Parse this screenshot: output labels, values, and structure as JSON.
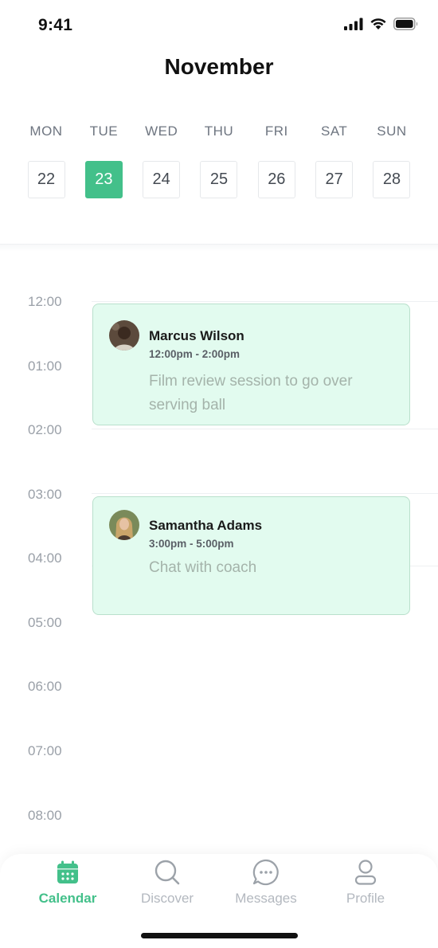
{
  "status_bar": {
    "time": "9:41"
  },
  "header": {
    "month": "November"
  },
  "week": {
    "days": [
      {
        "name": "MON",
        "date": "22"
      },
      {
        "name": "TUE",
        "date": "23"
      },
      {
        "name": "WED",
        "date": "24"
      },
      {
        "name": "THU",
        "date": "25"
      },
      {
        "name": "FRI",
        "date": "26"
      },
      {
        "name": "SAT",
        "date": "27"
      },
      {
        "name": "SUN",
        "date": "28"
      }
    ],
    "selected_date": "23"
  },
  "timeline": {
    "hours": [
      "12:00",
      "01:00",
      "02:00",
      "03:00",
      "04:00",
      "05:00",
      "06:00",
      "07:00",
      "08:00"
    ],
    "events": [
      {
        "name": "Marcus Wilson",
        "time": "12:00pm - 2:00pm",
        "description": "Film review session to go over serving ball"
      },
      {
        "name": "Samantha Adams",
        "time": "3:00pm - 5:00pm",
        "description": "Chat with coach"
      }
    ]
  },
  "tabs": [
    {
      "label": "Calendar",
      "icon": "calendar-icon",
      "active": true
    },
    {
      "label": "Discover",
      "icon": "search-icon",
      "active": false
    },
    {
      "label": "Messages",
      "icon": "chat-bubble-icon",
      "active": false
    },
    {
      "label": "Profile",
      "icon": "person-icon",
      "active": false
    }
  ],
  "colors": {
    "accent": "#43c08a",
    "event_bg": "#e2fbef",
    "event_border": "#b9e0cc"
  }
}
